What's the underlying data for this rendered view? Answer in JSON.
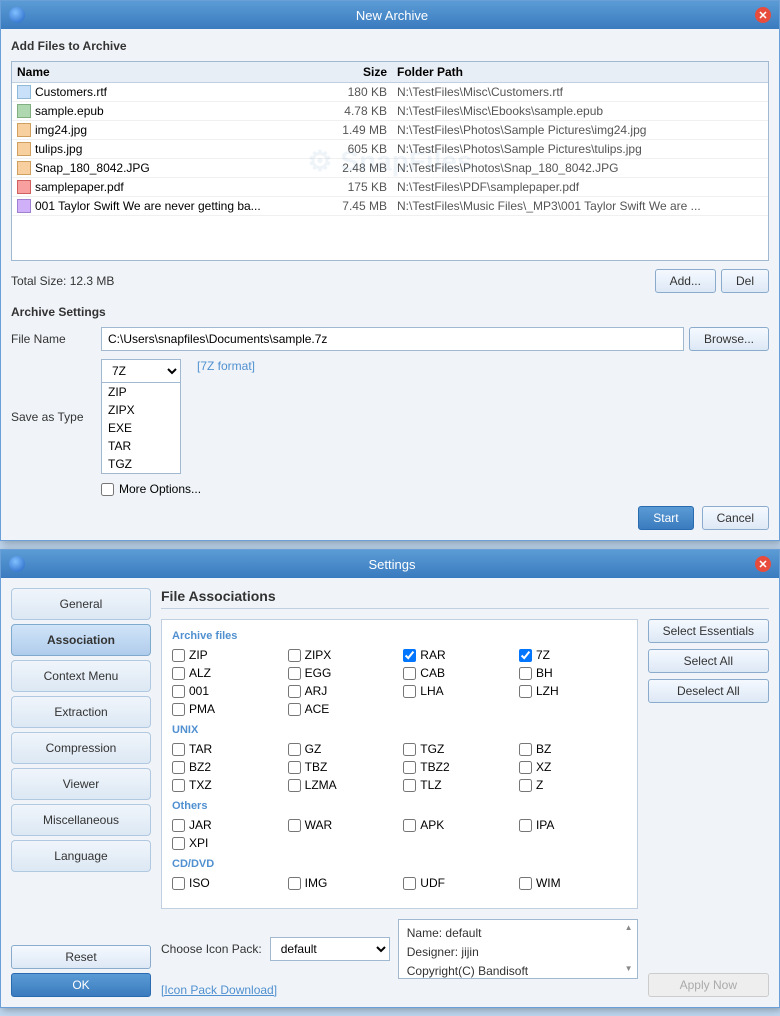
{
  "archive_window": {
    "title": "New Archive",
    "section_add": "Add Files to Archive",
    "columns": {
      "name": "Name",
      "size": "Size",
      "path": "Folder Path"
    },
    "files": [
      {
        "icon": "doc",
        "name": "Customers.rtf",
        "size": "180 KB",
        "path": "N:\\TestFiles\\Misc\\Customers.rtf"
      },
      {
        "icon": "epub",
        "name": "sample.epub",
        "size": "4.78 KB",
        "path": "N:\\TestFiles\\Misc\\Ebooks\\sample.epub"
      },
      {
        "icon": "img",
        "name": "img24.jpg",
        "size": "1.49 MB",
        "path": "N:\\TestFiles\\Photos\\Sample Pictures\\img24.jpg"
      },
      {
        "icon": "img",
        "name": "tulips.jpg",
        "size": "605 KB",
        "path": "N:\\TestFiles\\Photos\\Sample Pictures\\tulips.jpg"
      },
      {
        "icon": "img",
        "name": "Snap_180_8042.JPG",
        "size": "2.48 MB",
        "path": "N:\\TestFiles\\Photos\\Snap_180_8042.JPG"
      },
      {
        "icon": "pdf",
        "name": "samplepaper.pdf",
        "size": "175 KB",
        "path": "N:\\TestFiles\\PDF\\samplepaper.pdf"
      },
      {
        "icon": "music",
        "name": "001 Taylor Swift We are never getting ba...",
        "size": "7.45 MB",
        "path": "N:\\TestFiles\\Music Files\\_MP3\\001 Taylor Swift We are ..."
      }
    ],
    "total_size_label": "Total Size: 12.3 MB",
    "btn_add": "Add...",
    "btn_del": "Del",
    "section_settings": "Archive Settings",
    "file_name_label": "File Name",
    "file_name_value": "C:\\Users\\snapfiles\\Documents\\sample.7z",
    "btn_browse": "Browse...",
    "save_type_label": "Save as Type",
    "save_type_value": "7Z",
    "format_hint": "[7Z format]",
    "dropdown_options": [
      "ZIP",
      "ZIPX",
      "EXE",
      "TAR",
      "TGZ"
    ],
    "more_options_label": "More Options...",
    "btn_start": "Start",
    "btn_cancel": "Cancel"
  },
  "settings_window": {
    "title": "Settings",
    "sidebar": [
      {
        "id": "general",
        "label": "General"
      },
      {
        "id": "association",
        "label": "Association"
      },
      {
        "id": "context",
        "label": "Context Menu"
      },
      {
        "id": "extraction",
        "label": "Extraction"
      },
      {
        "id": "compression",
        "label": "Compression"
      },
      {
        "id": "viewer",
        "label": "Viewer"
      },
      {
        "id": "miscellaneous",
        "label": "Miscellaneous"
      },
      {
        "id": "language",
        "label": "Language"
      }
    ],
    "active_tab": "association",
    "main_title": "File Associations",
    "archive_group": "Archive files",
    "unix_group": "UNIX",
    "others_group": "Others",
    "cddvd_group": "CD/DVD",
    "archive_files": [
      {
        "id": "zip",
        "label": "ZIP",
        "checked": false
      },
      {
        "id": "zipx",
        "label": "ZIPX",
        "checked": false
      },
      {
        "id": "rar",
        "label": "RAR",
        "checked": true
      },
      {
        "id": "7z",
        "label": "7Z",
        "checked": true
      },
      {
        "id": "alz",
        "label": "ALZ",
        "checked": false
      },
      {
        "id": "egg",
        "label": "EGG",
        "checked": false
      },
      {
        "id": "cab",
        "label": "CAB",
        "checked": false
      },
      {
        "id": "bh",
        "label": "BH",
        "checked": false
      },
      {
        "id": "001",
        "label": "001",
        "checked": false
      },
      {
        "id": "arj",
        "label": "ARJ",
        "checked": false
      },
      {
        "id": "lha",
        "label": "LHA",
        "checked": false
      },
      {
        "id": "lzh",
        "label": "LZH",
        "checked": false
      },
      {
        "id": "pma",
        "label": "PMA",
        "checked": false
      },
      {
        "id": "ace",
        "label": "ACE",
        "checked": false
      }
    ],
    "unix_files": [
      {
        "id": "tar",
        "label": "TAR",
        "checked": false
      },
      {
        "id": "gz",
        "label": "GZ",
        "checked": false
      },
      {
        "id": "tgz",
        "label": "TGZ",
        "checked": false
      },
      {
        "id": "bz",
        "label": "BZ",
        "checked": false
      },
      {
        "id": "bz2",
        "label": "BZ2",
        "checked": false
      },
      {
        "id": "tbz",
        "label": "TBZ",
        "checked": false
      },
      {
        "id": "tbz2",
        "label": "TBZ2",
        "checked": false
      },
      {
        "id": "xz",
        "label": "XZ",
        "checked": false
      },
      {
        "id": "txz",
        "label": "TXZ",
        "checked": false
      },
      {
        "id": "lzma",
        "label": "LZMA",
        "checked": false
      },
      {
        "id": "tlz",
        "label": "TLZ",
        "checked": false
      },
      {
        "id": "z",
        "label": "Z",
        "checked": false
      }
    ],
    "other_files": [
      {
        "id": "jar",
        "label": "JAR",
        "checked": false
      },
      {
        "id": "war",
        "label": "WAR",
        "checked": false
      },
      {
        "id": "apk",
        "label": "APK",
        "checked": false
      },
      {
        "id": "ipa",
        "label": "IPA",
        "checked": false
      },
      {
        "id": "xpi",
        "label": "XPI",
        "checked": false
      }
    ],
    "cddvd_files": [
      {
        "id": "iso",
        "label": "ISO",
        "checked": false
      },
      {
        "id": "img",
        "label": "IMG",
        "checked": false
      },
      {
        "id": "udf",
        "label": "UDF",
        "checked": false
      },
      {
        "id": "wim",
        "label": "WIM",
        "checked": false
      }
    ],
    "btn_select_essentials": "Select Essentials",
    "btn_select_all": "Select All",
    "btn_deselect_all": "Deselect All",
    "btn_apply_now": "Apply Now",
    "icon_pack_label": "Choose Icon Pack:",
    "icon_pack_value": "default",
    "icon_pack_info": {
      "name": "Name: default",
      "designer": "Designer: jijin",
      "copyright": "Copyright(C) Bandisoft"
    },
    "icon_pack_download": "[Icon Pack Download]",
    "btn_reset": "Reset",
    "btn_ok": "OK"
  }
}
